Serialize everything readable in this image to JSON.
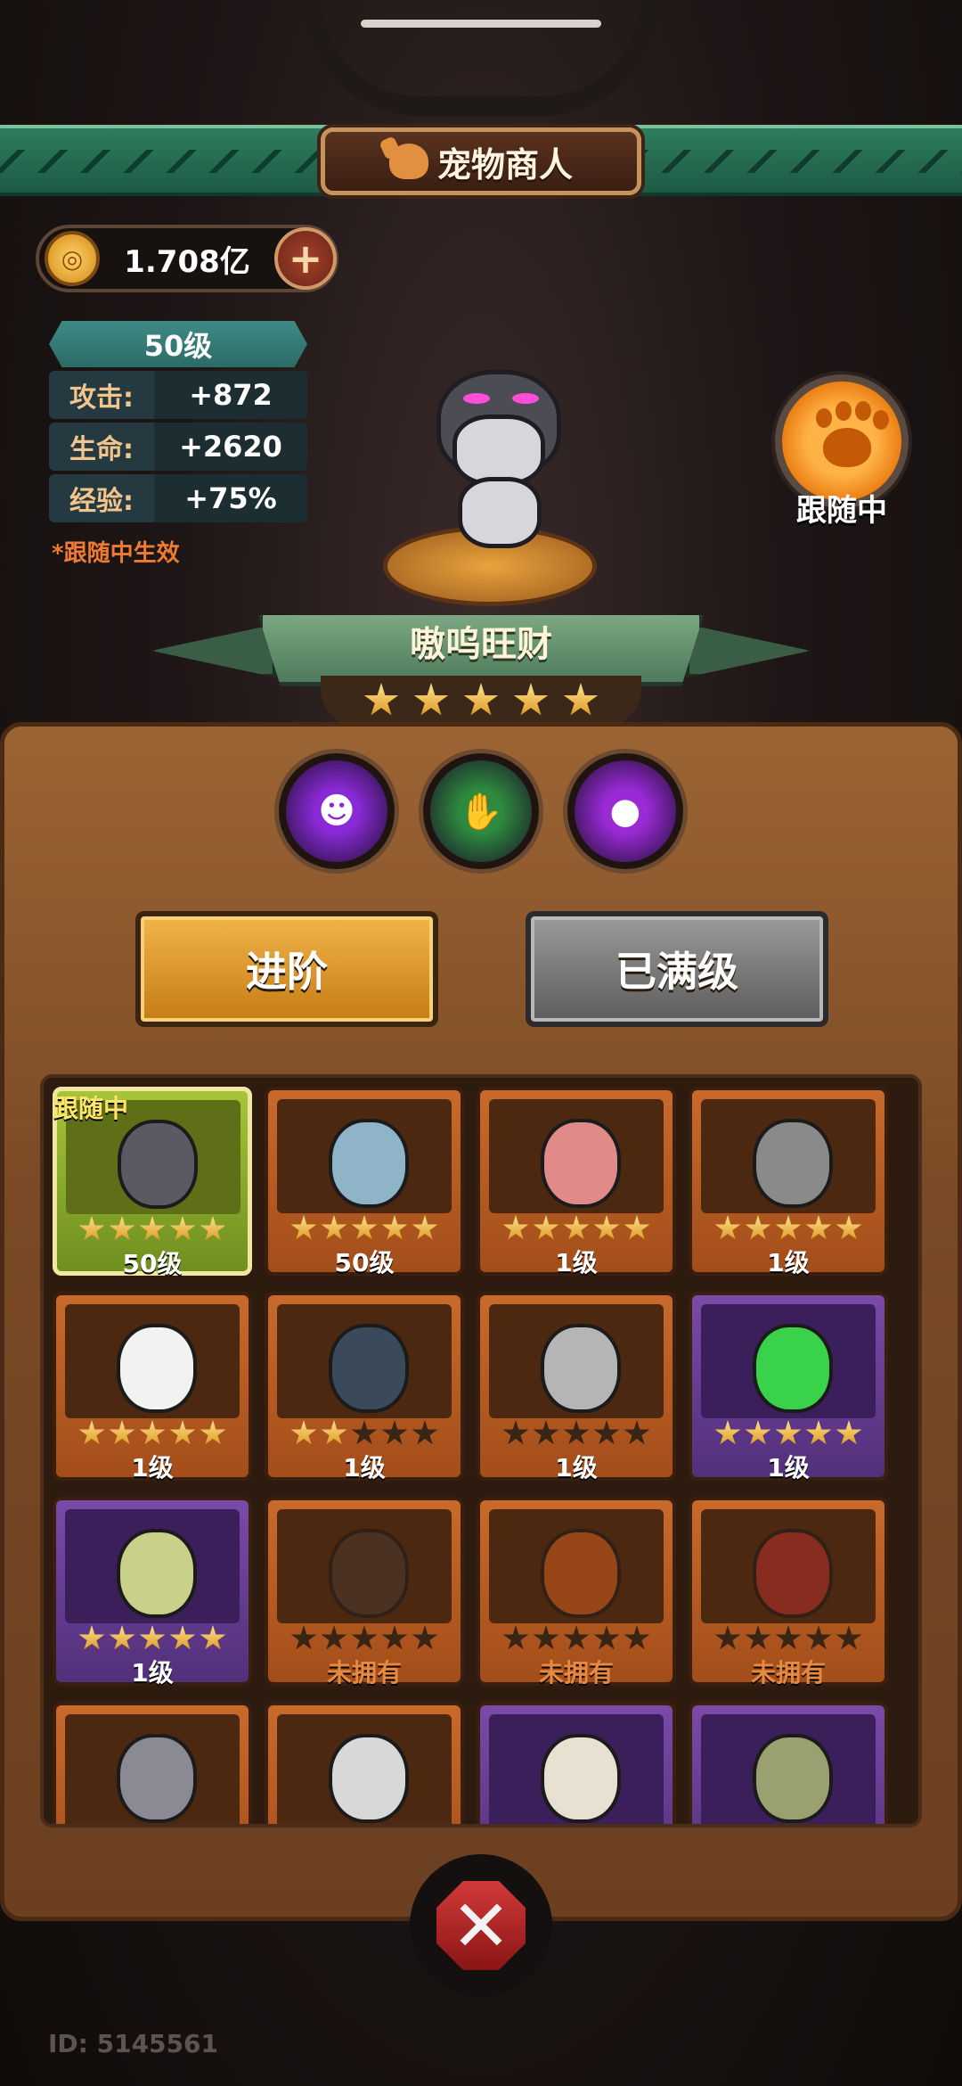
{
  "header": {
    "title": "宠物商人"
  },
  "currency": {
    "amount": "1.708亿",
    "add_symbol": "+"
  },
  "stats": {
    "level": "50级",
    "rows": [
      {
        "label": "攻击:",
        "value": "+872"
      },
      {
        "label": "生命:",
        "value": "+2620"
      },
      {
        "label": "经验:",
        "value": "+75%"
      }
    ],
    "note": "*跟随中生效"
  },
  "follow_status": "跟随中",
  "pet": {
    "name": "嗷呜旺财",
    "stars": 5
  },
  "skills": [
    {
      "icon": "shadow-demon-icon",
      "color": "#8a2ad6"
    },
    {
      "icon": "green-claw-icon",
      "color": "#2e8a3e"
    },
    {
      "icon": "purple-bubble-icon",
      "color": "#9a2ad6"
    }
  ],
  "buttons": {
    "advance": "进阶",
    "maxed": "已满级"
  },
  "grid": {
    "follow_tag": "跟随中",
    "cards": [
      {
        "name": "gray-wolf-pet",
        "rarity": "selected",
        "stars": 5,
        "level": "50级",
        "owned": true,
        "color": "#5a5a64"
      },
      {
        "name": "ice-spider-pet",
        "rarity": "orange",
        "stars": 5,
        "level": "50级",
        "owned": true,
        "color": "#8fb4c8"
      },
      {
        "name": "pink-boar-pet",
        "rarity": "orange",
        "stars": 5,
        "level": "1级",
        "owned": true,
        "color": "#e08a8a"
      },
      {
        "name": "helmet-chick-pet",
        "rarity": "orange",
        "stars": 5,
        "level": "1级",
        "owned": true,
        "color": "#8a8a8a"
      },
      {
        "name": "ronin-goose-pet",
        "rarity": "orange",
        "stars": 5,
        "level": "1级",
        "owned": true,
        "color": "#f2f2f2"
      },
      {
        "name": "plague-crow-pet",
        "rarity": "orange",
        "stars": 2,
        "level": "1级",
        "owned": true,
        "color": "#3a4a5a"
      },
      {
        "name": "knight-pet",
        "rarity": "orange",
        "stars": 0,
        "level": "1级",
        "owned": true,
        "color": "#b5b5b5"
      },
      {
        "name": "green-frog-pet",
        "rarity": "purple",
        "stars": 5,
        "level": "1级",
        "owned": true,
        "color": "#3ad24a"
      },
      {
        "name": "forest-spirit-pet",
        "rarity": "purple",
        "stars": 5,
        "level": "1级",
        "owned": true,
        "color": "#c8d08a"
      },
      {
        "name": "mimic-chest-pet",
        "rarity": "orange",
        "stars": 0,
        "level": "未拥有",
        "owned": false,
        "color": "#4a3a30"
      },
      {
        "name": "fire-dragon-pet",
        "rarity": "orange",
        "stars": 0,
        "level": "未拥有",
        "owned": false,
        "color": "#d2601e"
      },
      {
        "name": "daruma-pet",
        "rarity": "orange",
        "stars": 0,
        "level": "未拥有",
        "owned": false,
        "color": "#b8302a"
      },
      {
        "name": "gauntlet-pet",
        "rarity": "orange",
        "stars": 0,
        "level": "",
        "owned": true,
        "color": "#8a8a94"
      },
      {
        "name": "clown-pet",
        "rarity": "orange",
        "stars": 0,
        "level": "",
        "owned": true,
        "color": "#d8d8d8"
      },
      {
        "name": "rooster-pet",
        "rarity": "purple",
        "stars": 0,
        "level": "",
        "owned": true,
        "color": "#e8e0d0"
      },
      {
        "name": "zombie-bird-pet",
        "rarity": "purple",
        "stars": 0,
        "level": "",
        "owned": true,
        "color": "#9aa070"
      }
    ]
  },
  "user_id": "ID: 5145561"
}
